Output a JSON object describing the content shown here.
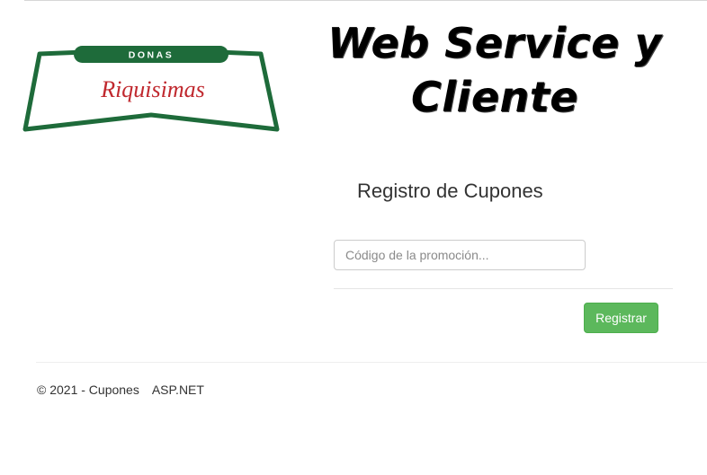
{
  "header": {
    "logo": {
      "top_text": "DONAS",
      "script_text": "Riquisimas",
      "border_color": "#1e6b3a",
      "script_color": "#c0282e"
    },
    "headline": {
      "line1": "Web Service y",
      "line2": "Cliente"
    }
  },
  "form": {
    "title": "Registro de Cupones",
    "promo_input": {
      "value": "",
      "placeholder": "Código de la promoción..."
    },
    "register_label": "Registrar",
    "accent_color": "#5cb85c"
  },
  "footer": {
    "copyright": "© 2021 - Cupones",
    "framework": "ASP.NET"
  }
}
